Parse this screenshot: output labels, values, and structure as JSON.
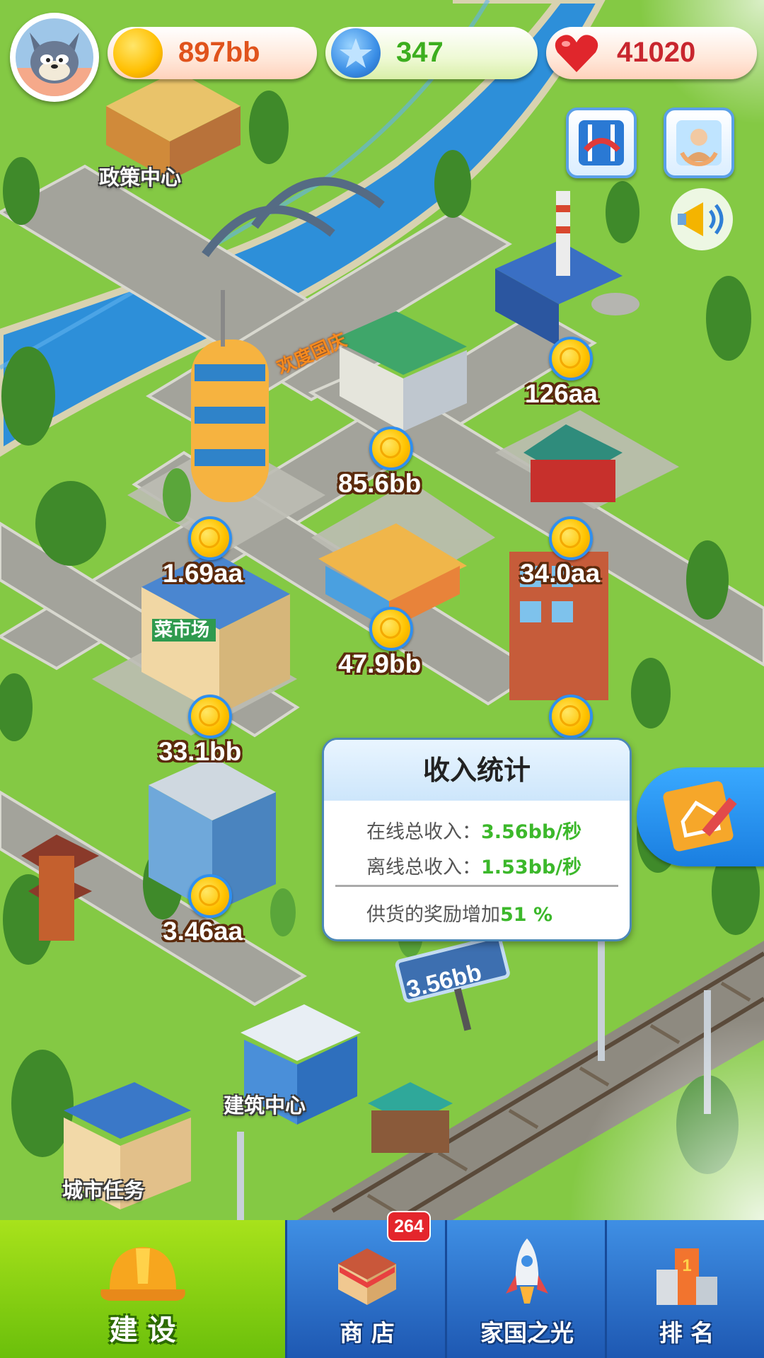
{
  "hud": {
    "gold": "897bb",
    "gems": "347",
    "hearts": "41020",
    "icons": [
      "avatar-tom-cat",
      "gold-coin-icon",
      "blue-star-gem-icon",
      "heart-icon",
      "bridge-event-icon",
      "elder-helper-icon",
      "megaphone-icon"
    ]
  },
  "buildings": [
    {
      "label": "政策中心"
    },
    {
      "label": "建筑中心"
    },
    {
      "label": "城市任务"
    },
    {
      "label": "菜市场"
    },
    {
      "label": "欢度国庆"
    }
  ],
  "incomes": [
    {
      "value": "126aa"
    },
    {
      "value": "85.6bb"
    },
    {
      "value": "1.69aa"
    },
    {
      "value": "34.0aa"
    },
    {
      "value": "47.9bb"
    },
    {
      "value": "33.1bb"
    },
    {
      "value": "3.46aa"
    }
  ],
  "billboard": "3.56bb",
  "stats_popup": {
    "title": "收入统计",
    "online_label": "在线总收入：",
    "online_value": "3.56bb/秒",
    "offline_label": "离线总收入：",
    "offline_value": "1.53bb/秒",
    "bonus_label": "供货的奖励增加",
    "bonus_value": "51 %"
  },
  "tabs": {
    "build": "建 设",
    "shop": "商 店",
    "shop_badge": "264",
    "homeland": "家国之光",
    "rank": "排 名"
  },
  "colors": {
    "grass": "#7cc63e",
    "river": "#2d8fd9",
    "road": "#9a9a92",
    "gold_text": "#e0531c",
    "gem_text": "#3cae1e",
    "heart_text": "#c8262e",
    "tab_active": "#8fd113",
    "tab_bar": "#1f63bf"
  }
}
